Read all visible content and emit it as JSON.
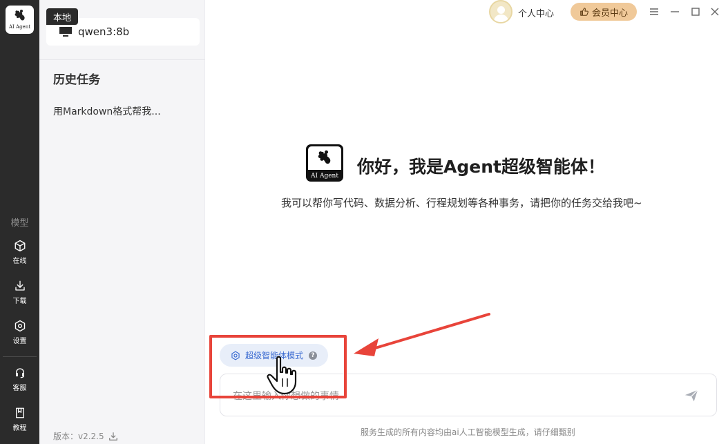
{
  "app": {
    "logo_text": "AI Agent"
  },
  "rail": {
    "section_label": "模型",
    "items": [
      {
        "label": "在线",
        "icon": "cube-icon"
      },
      {
        "label": "下载",
        "icon": "download-icon"
      },
      {
        "label": "设置",
        "icon": "gear-icon"
      },
      {
        "label": "客服",
        "icon": "headset-icon"
      },
      {
        "label": "教程",
        "icon": "book-icon"
      }
    ]
  },
  "sidebar": {
    "local_tag": "本地",
    "model_name": "qwen3:8b",
    "history_title": "历史任务",
    "history_items": [
      "用Markdown格式帮我..."
    ],
    "version": "版本：v2.2.5"
  },
  "header": {
    "profile_label": "个人中心",
    "vip_label": "会员中心"
  },
  "welcome": {
    "logo_text": "AI Agent",
    "title": "你好，我是Agent超级智能体！",
    "subtitle": "我可以帮你写代码、数据分析、行程规划等各种事务，请把你的任务交给我吧~"
  },
  "mode_chip": {
    "label": "超级智能体模式",
    "help": "?"
  },
  "input": {
    "placeholder": "在这里输入你想做的事情"
  },
  "footer": {
    "disclaimer": "服务生成的所有内容均由ai人工智能模型生成，请仔细甄别"
  },
  "colors": {
    "rail_bg": "#2b2b2b",
    "sidebar_bg": "#f5f5f7",
    "vip_bg": "#f0c999",
    "chip_bg": "#e8eef9",
    "chip_text": "#3b6bd1",
    "annotation": "#e8443a"
  }
}
